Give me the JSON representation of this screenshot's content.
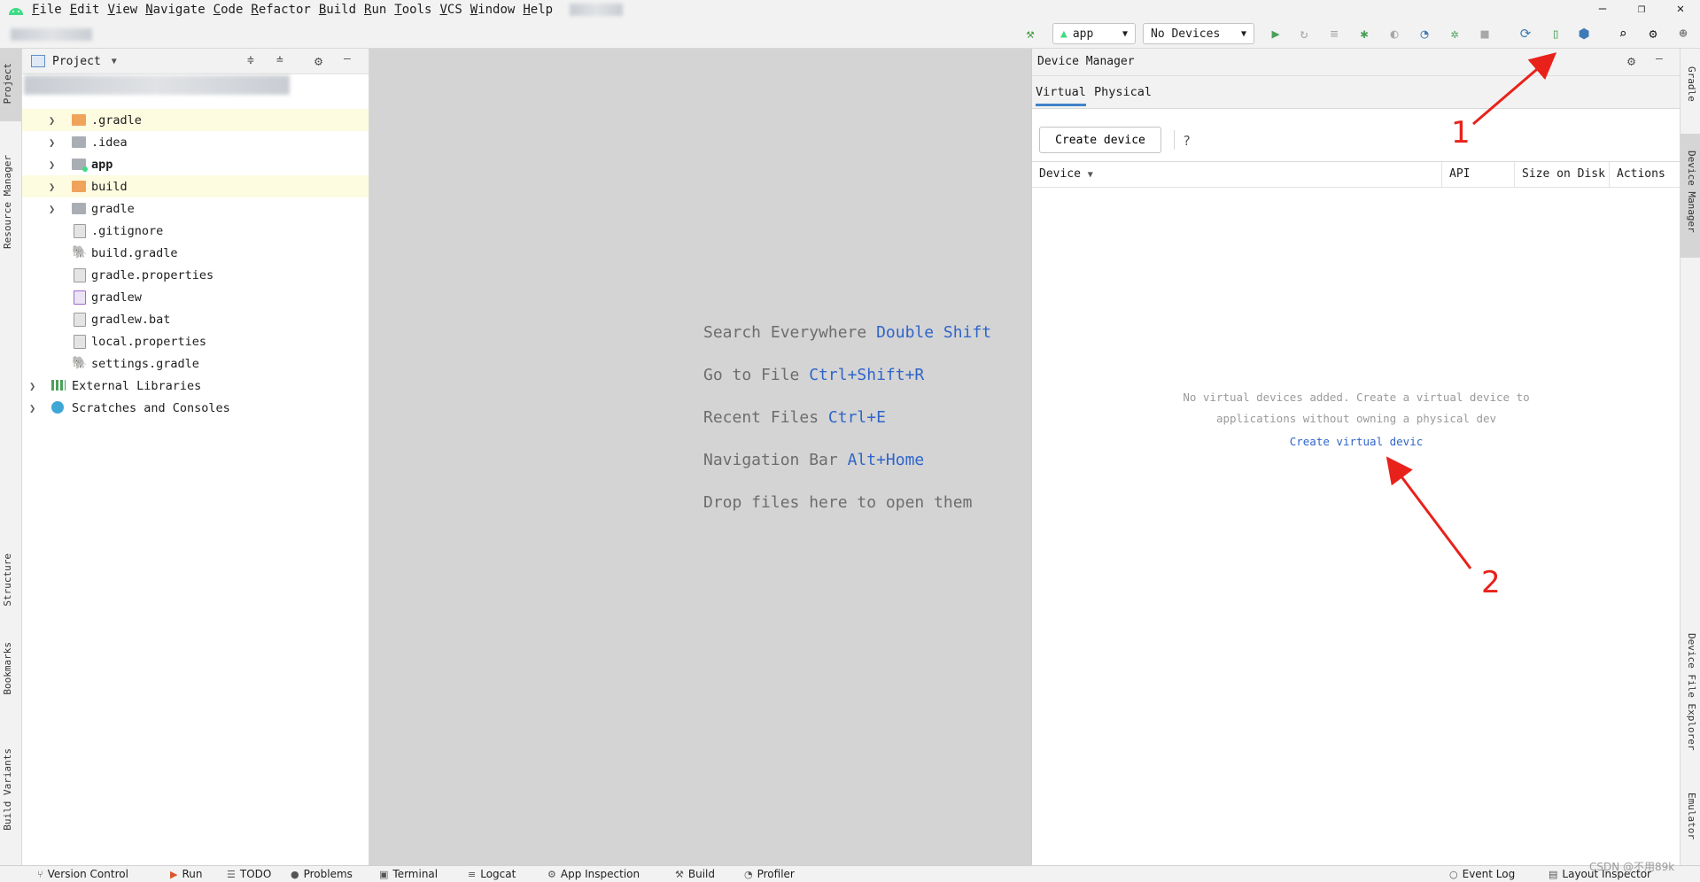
{
  "menu": [
    "File",
    "Edit",
    "View",
    "Navigate",
    "Code",
    "Refactor",
    "Build",
    "Run",
    "Tools",
    "VCS",
    "Window",
    "Help"
  ],
  "toolbar": {
    "run_config": "app",
    "device_selector": "No Devices"
  },
  "left_tabs": [
    "Project",
    "Resource Manager",
    "Structure",
    "Bookmarks",
    "Build Variants"
  ],
  "right_tabs": [
    "Gradle",
    "Device Manager",
    "Device File Explorer",
    "Emulator"
  ],
  "project": {
    "title": "Project",
    "items": [
      {
        "label": ".gradle",
        "icon": "folder-icon"
      },
      {
        "label": ".idea",
        "icon": "folder-icon"
      },
      {
        "label": "app",
        "icon": "module-folder-icon"
      },
      {
        "label": "build",
        "icon": "folder-icon"
      },
      {
        "label": "gradle",
        "icon": "folder-icon"
      },
      {
        "label": ".gitignore",
        "icon": "gitignore-file-icon"
      },
      {
        "label": "build.gradle",
        "icon": "gradle-file-icon"
      },
      {
        "label": "gradle.properties",
        "icon": "properties-file-icon"
      },
      {
        "label": "gradlew",
        "icon": "script-file-icon"
      },
      {
        "label": "gradlew.bat",
        "icon": "text-file-icon"
      },
      {
        "label": "local.properties",
        "icon": "properties-file-icon"
      },
      {
        "label": "settings.gradle",
        "icon": "gradle-file-icon"
      },
      {
        "label": "External Libraries",
        "icon": "libraries-icon"
      },
      {
        "label": "Scratches and Consoles",
        "icon": "scratches-icon"
      }
    ]
  },
  "editor_hints": [
    {
      "text": "Search Everywhere",
      "key": "Double Shift"
    },
    {
      "text": "Go to File",
      "key": "Ctrl+Shift+R"
    },
    {
      "text": "Recent Files",
      "key": "Ctrl+E"
    },
    {
      "text": "Navigation Bar",
      "key": "Alt+Home"
    },
    {
      "text": "Drop files here to open them",
      "key": ""
    }
  ],
  "device_manager": {
    "title": "Device Manager",
    "tabs": [
      "Virtual",
      "Physical"
    ],
    "create_button": "Create device",
    "help": "?",
    "columns": [
      "Device",
      "API",
      "Size on Disk",
      "Actions"
    ],
    "empty_line1": "No virtual devices added. Create a virtual device to",
    "empty_line2": "applications without owning a physical dev",
    "create_link": "Create virtual devic"
  },
  "statusbar": {
    "left": [
      "Version Control",
      "Run",
      "TODO",
      "Problems",
      "Terminal",
      "Logcat",
      "App Inspection",
      "Build",
      "Profiler"
    ],
    "right": [
      "Event Log",
      "Layout Inspector"
    ],
    "watermark": "CSDN @不用89k"
  },
  "annotations": [
    "1",
    "2"
  ]
}
